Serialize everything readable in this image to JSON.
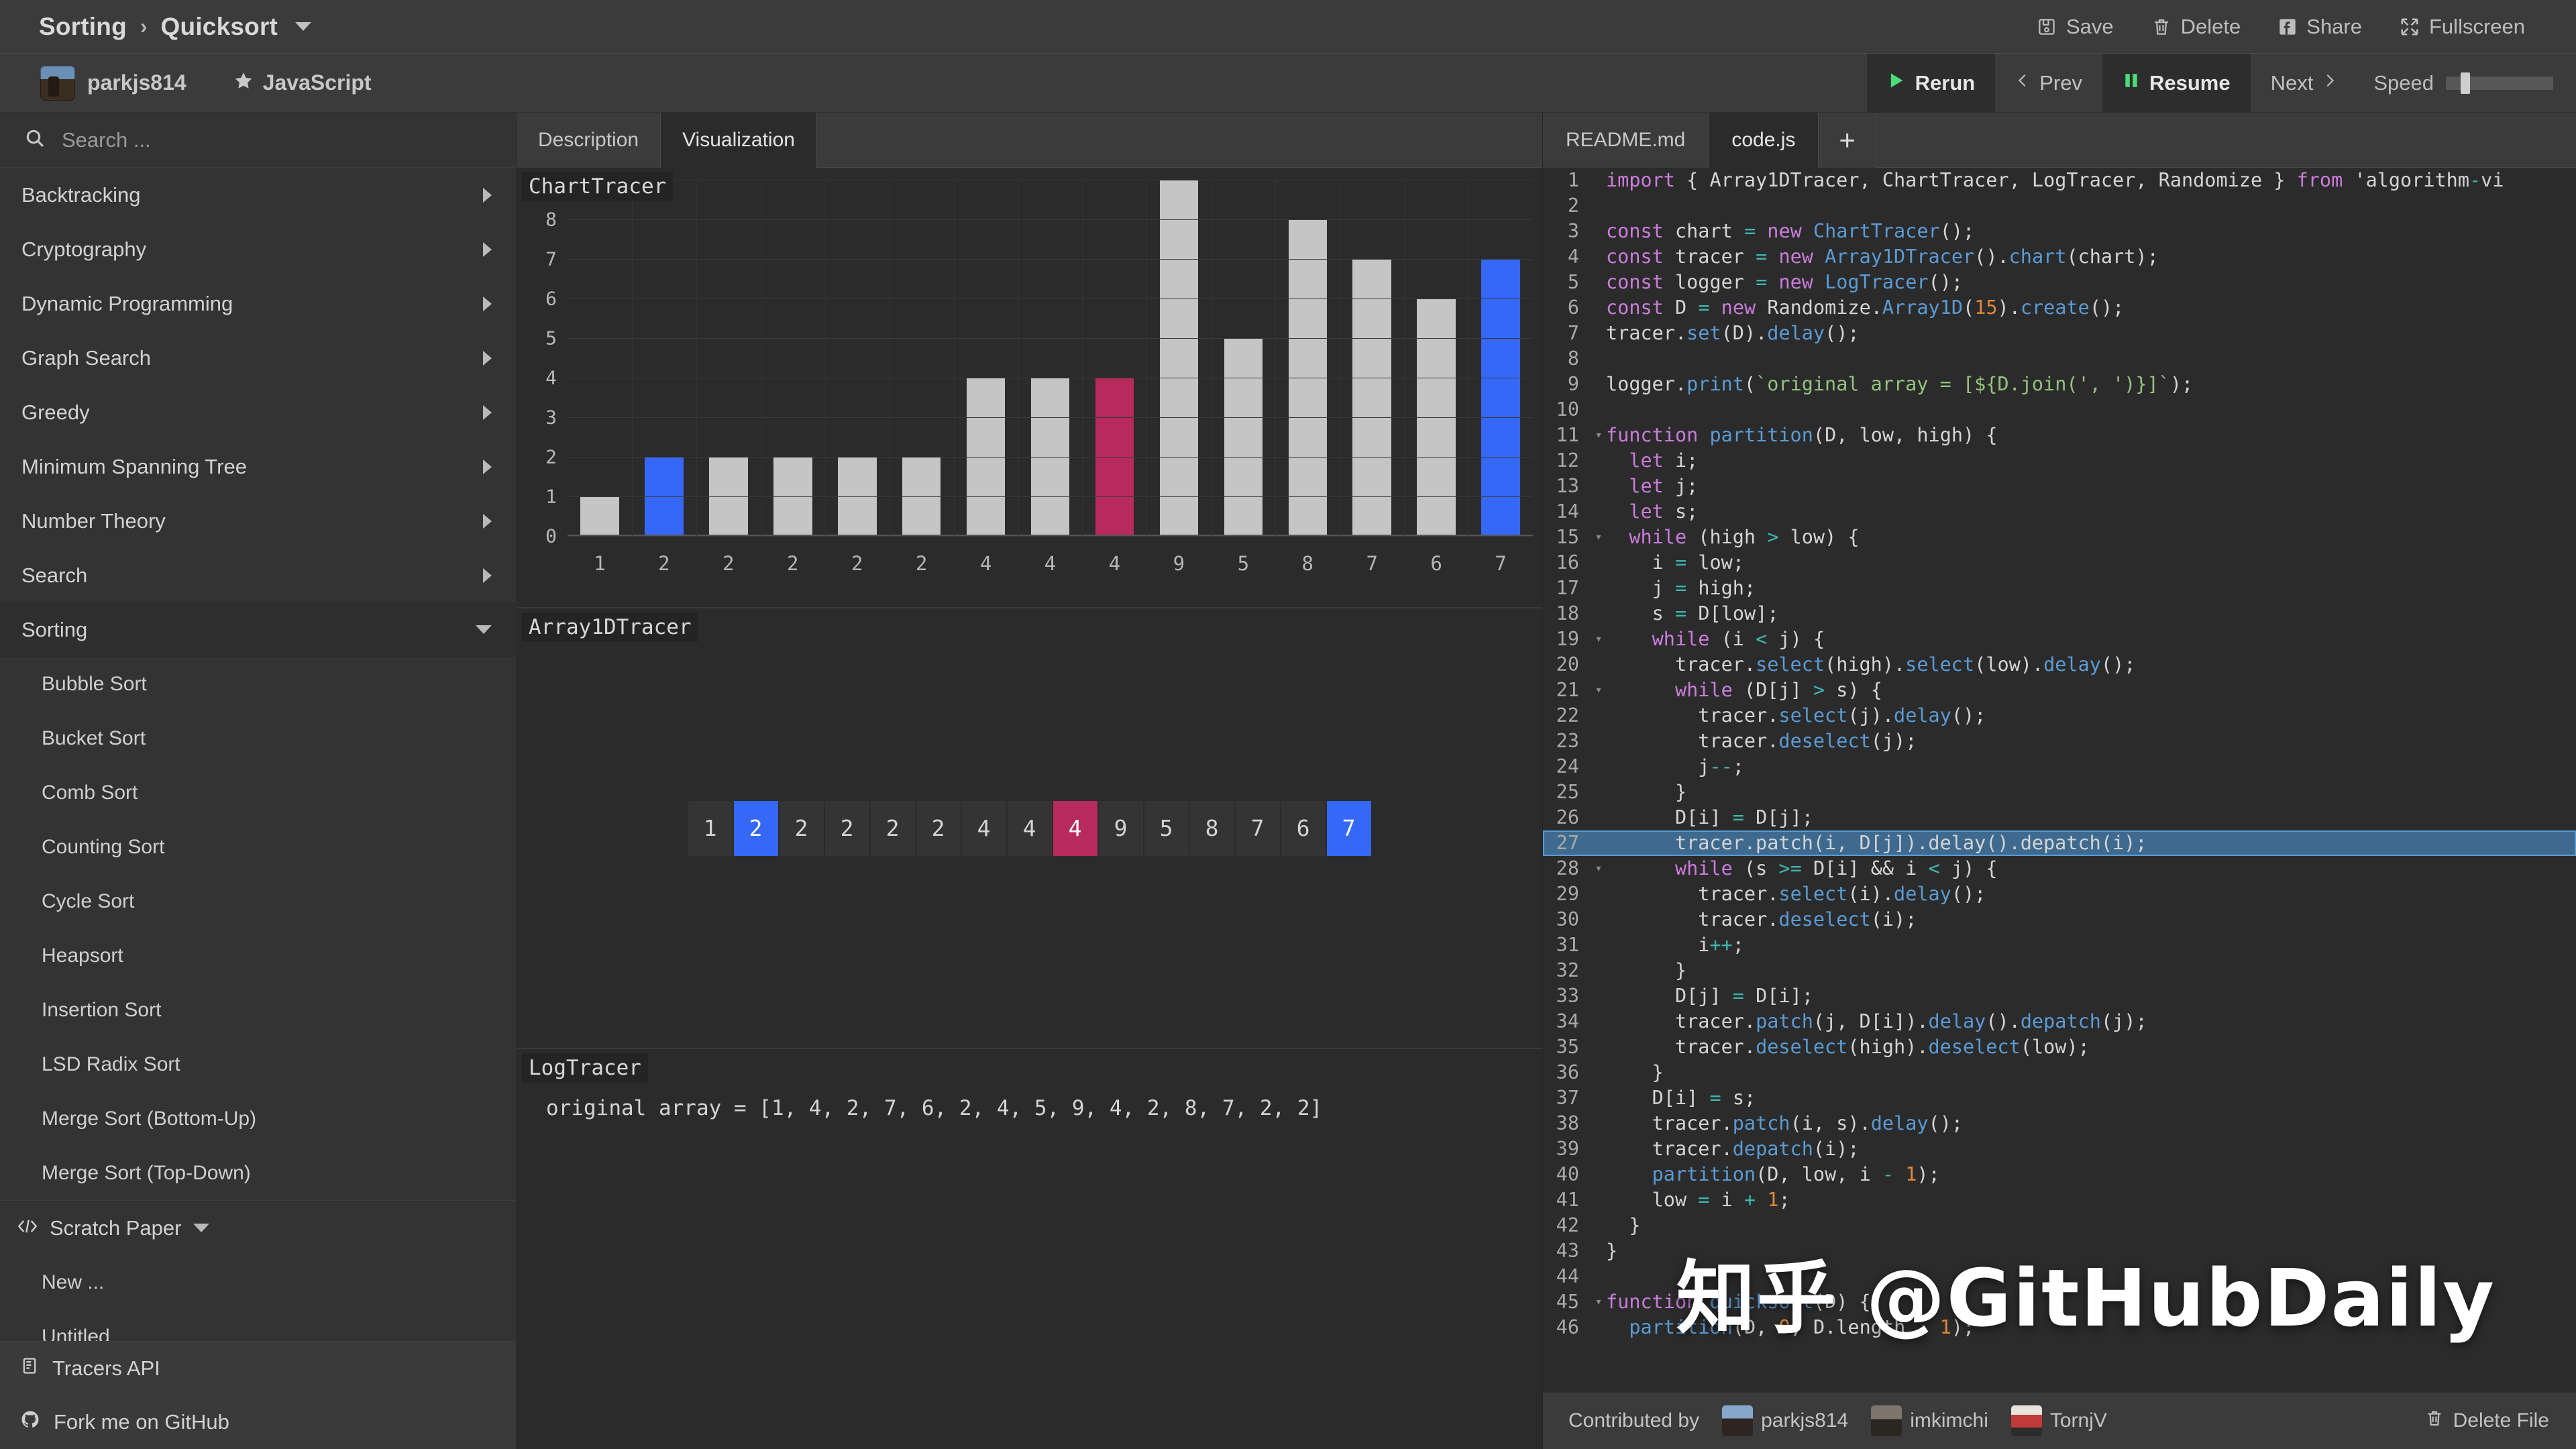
{
  "header": {
    "breadcrumb_root": "Sorting",
    "breadcrumb_sep": "›",
    "breadcrumb_current": "Quicksort",
    "actions": [
      {
        "label": "Save",
        "icon": "save-icon"
      },
      {
        "label": "Delete",
        "icon": "trash-icon"
      },
      {
        "label": "Share",
        "icon": "facebook-icon"
      },
      {
        "label": "Fullscreen",
        "icon": "fullscreen-icon"
      }
    ]
  },
  "subbar": {
    "owner": "parkjs814",
    "language": "JavaScript",
    "player": {
      "rerun": "Rerun",
      "prev": "Prev",
      "resume": "Resume",
      "next": "Next",
      "speed_label": "Speed"
    }
  },
  "sidebar": {
    "search_placeholder": "Search ...",
    "categories": [
      {
        "label": "Backtracking",
        "expanded": false
      },
      {
        "label": "Cryptography",
        "expanded": false
      },
      {
        "label": "Dynamic Programming",
        "expanded": false
      },
      {
        "label": "Graph Search",
        "expanded": false
      },
      {
        "label": "Greedy",
        "expanded": false
      },
      {
        "label": "Minimum Spanning Tree",
        "expanded": false
      },
      {
        "label": "Number Theory",
        "expanded": false
      },
      {
        "label": "Search",
        "expanded": false
      },
      {
        "label": "Sorting",
        "expanded": true
      }
    ],
    "sorting_items": [
      {
        "label": "Bubble Sort"
      },
      {
        "label": "Bucket Sort"
      },
      {
        "label": "Comb Sort"
      },
      {
        "label": "Counting Sort"
      },
      {
        "label": "Cycle Sort"
      },
      {
        "label": "Heapsort"
      },
      {
        "label": "Insertion Sort"
      },
      {
        "label": "LSD Radix Sort"
      },
      {
        "label": "Merge Sort (Bottom-Up)"
      },
      {
        "label": "Merge Sort (Top-Down)"
      }
    ],
    "scratch_paper": {
      "label": "Scratch Paper",
      "items": [
        {
          "label": "New ..."
        },
        {
          "label": "Untitled"
        }
      ]
    },
    "footer": [
      {
        "label": "Tracers API",
        "icon": "book-icon"
      },
      {
        "label": "Fork me on GitHub",
        "icon": "github-icon"
      }
    ]
  },
  "viz": {
    "tabs": [
      {
        "label": "Description",
        "active": false
      },
      {
        "label": "Visualization",
        "active": true
      }
    ],
    "chart_panel_title": "ChartTracer",
    "array_panel_title": "Array1DTracer",
    "log_panel_title": "LogTracer",
    "log_line": "original array = [1, 4, 2, 7, 6, 2, 4, 5, 9, 4, 2, 8, 7, 2, 2]",
    "array_cells": [
      {
        "value": "1",
        "state": "normal"
      },
      {
        "value": "2",
        "state": "selected"
      },
      {
        "value": "2",
        "state": "normal"
      },
      {
        "value": "2",
        "state": "normal"
      },
      {
        "value": "2",
        "state": "normal"
      },
      {
        "value": "2",
        "state": "normal"
      },
      {
        "value": "4",
        "state": "normal"
      },
      {
        "value": "4",
        "state": "normal"
      },
      {
        "value": "4",
        "state": "patched"
      },
      {
        "value": "9",
        "state": "normal"
      },
      {
        "value": "5",
        "state": "normal"
      },
      {
        "value": "8",
        "state": "normal"
      },
      {
        "value": "7",
        "state": "normal"
      },
      {
        "value": "6",
        "state": "normal"
      },
      {
        "value": "7",
        "state": "selected"
      }
    ],
    "colors": {
      "selected": "#3568f6",
      "patched": "#b62a5c",
      "normal": "#c5c5c5"
    }
  },
  "chart_data": {
    "type": "bar",
    "title": "ChartTracer",
    "xlabel": "",
    "ylabel": "",
    "ylim": [
      0,
      9
    ],
    "yticks": [
      0,
      1,
      2,
      3,
      4,
      5,
      6,
      7,
      8,
      9
    ],
    "grid": true,
    "legend": "none",
    "categories": [
      "1",
      "2",
      "2",
      "2",
      "2",
      "2",
      "4",
      "4",
      "4",
      "9",
      "5",
      "8",
      "7",
      "6",
      "7"
    ],
    "values": [
      1,
      2,
      2,
      2,
      2,
      2,
      4,
      4,
      4,
      9,
      5,
      8,
      7,
      6,
      7
    ],
    "bar_states": [
      "normal",
      "selected",
      "normal",
      "normal",
      "normal",
      "normal",
      "normal",
      "normal",
      "patched",
      "normal",
      "normal",
      "normal",
      "normal",
      "normal",
      "selected"
    ]
  },
  "code": {
    "tabs": [
      {
        "label": "README.md",
        "active": false
      },
      {
        "label": "code.js",
        "active": true
      },
      {
        "label": "+",
        "active": false
      }
    ],
    "highlight_line": 27,
    "lines": [
      {
        "n": 1,
        "fold": "",
        "text": "import { Array1DTracer, ChartTracer, LogTracer, Randomize } from 'algorithm-vi"
      },
      {
        "n": 2,
        "fold": "",
        "text": ""
      },
      {
        "n": 3,
        "fold": "",
        "text": "const chart = new ChartTracer();"
      },
      {
        "n": 4,
        "fold": "",
        "text": "const tracer = new Array1DTracer().chart(chart);"
      },
      {
        "n": 5,
        "fold": "",
        "text": "const logger = new LogTracer();"
      },
      {
        "n": 6,
        "fold": "",
        "text": "const D = new Randomize.Array1D(15).create();"
      },
      {
        "n": 7,
        "fold": "",
        "text": "tracer.set(D).delay();"
      },
      {
        "n": 8,
        "fold": "",
        "text": ""
      },
      {
        "n": 9,
        "fold": "",
        "text": "logger.print(`original array = [${D.join(', ')}]`);"
      },
      {
        "n": 10,
        "fold": "",
        "text": ""
      },
      {
        "n": 11,
        "fold": "v",
        "text": "function partition(D, low, high) {"
      },
      {
        "n": 12,
        "fold": "",
        "text": "  let i;"
      },
      {
        "n": 13,
        "fold": "",
        "text": "  let j;"
      },
      {
        "n": 14,
        "fold": "",
        "text": "  let s;"
      },
      {
        "n": 15,
        "fold": "v",
        "text": "  while (high > low) {"
      },
      {
        "n": 16,
        "fold": "",
        "text": "    i = low;"
      },
      {
        "n": 17,
        "fold": "",
        "text": "    j = high;"
      },
      {
        "n": 18,
        "fold": "",
        "text": "    s = D[low];"
      },
      {
        "n": 19,
        "fold": "v",
        "text": "    while (i < j) {"
      },
      {
        "n": 20,
        "fold": "",
        "text": "      tracer.select(high).select(low).delay();"
      },
      {
        "n": 21,
        "fold": "v",
        "text": "      while (D[j] > s) {"
      },
      {
        "n": 22,
        "fold": "",
        "text": "        tracer.select(j).delay();"
      },
      {
        "n": 23,
        "fold": "",
        "text": "        tracer.deselect(j);"
      },
      {
        "n": 24,
        "fold": "",
        "text": "        j--;"
      },
      {
        "n": 25,
        "fold": "",
        "text": "      }"
      },
      {
        "n": 26,
        "fold": "",
        "text": "      D[i] = D[j];"
      },
      {
        "n": 27,
        "fold": "",
        "text": "      tracer.patch(i, D[j]).delay().depatch(i);"
      },
      {
        "n": 28,
        "fold": "v",
        "text": "      while (s >= D[i] && i < j) {"
      },
      {
        "n": 29,
        "fold": "",
        "text": "        tracer.select(i).delay();"
      },
      {
        "n": 30,
        "fold": "",
        "text": "        tracer.deselect(i);"
      },
      {
        "n": 31,
        "fold": "",
        "text": "        i++;"
      },
      {
        "n": 32,
        "fold": "",
        "text": "      }"
      },
      {
        "n": 33,
        "fold": "",
        "text": "      D[j] = D[i];"
      },
      {
        "n": 34,
        "fold": "",
        "text": "      tracer.patch(j, D[i]).delay().depatch(j);"
      },
      {
        "n": 35,
        "fold": "",
        "text": "      tracer.deselect(high).deselect(low);"
      },
      {
        "n": 36,
        "fold": "",
        "text": "    }"
      },
      {
        "n": 37,
        "fold": "",
        "text": "    D[i] = s;"
      },
      {
        "n": 38,
        "fold": "",
        "text": "    tracer.patch(i, s).delay();"
      },
      {
        "n": 39,
        "fold": "",
        "text": "    tracer.depatch(i);"
      },
      {
        "n": 40,
        "fold": "",
        "text": "    partition(D, low, i - 1);"
      },
      {
        "n": 41,
        "fold": "",
        "text": "    low = i + 1;"
      },
      {
        "n": 42,
        "fold": "",
        "text": "  }"
      },
      {
        "n": 43,
        "fold": "",
        "text": "}"
      },
      {
        "n": 44,
        "fold": "",
        "text": ""
      },
      {
        "n": 45,
        "fold": "v",
        "text": "function quicksort(D) {"
      },
      {
        "n": 46,
        "fold": "",
        "text": "  partition(D, 0, D.length - 1);"
      }
    ]
  },
  "contrib": {
    "label": "Contributed by",
    "users": [
      "parkjs814",
      "imkimchi",
      "TornjV"
    ],
    "delete_file": "Delete File"
  },
  "watermark": "知乎 @GitHubDaily"
}
